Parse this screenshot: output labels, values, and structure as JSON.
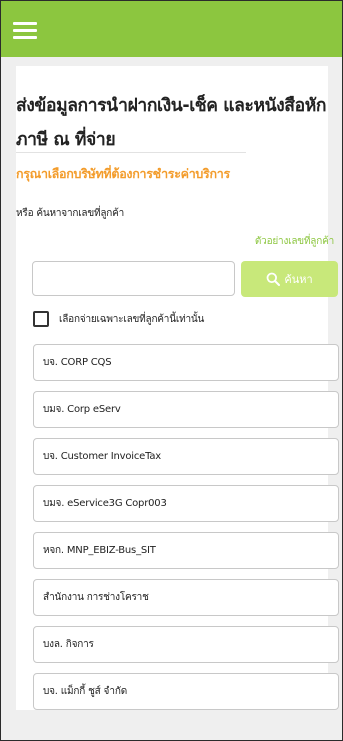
{
  "header": {
    "menu_icon": "hamburger-menu-icon",
    "color": "#8cc63f"
  },
  "page": {
    "title": "ส่งข้อมูลการนำฝากเงิน-เช็ค และหนังสือหักภาษี ณ ที่จ่าย",
    "subtitle": "กรุณาเลือกบริษัทที่ต้องการชำระค่าบริการ",
    "search_hint": "หรือ ค้นหาจากเลขที่ลูกค้า",
    "example_link": "ตัวอย่างเลขที่ลูกค้า"
  },
  "search": {
    "value": "",
    "placeholder": "",
    "button_label": "ค้นหา",
    "button_icon": "search-icon"
  },
  "filter": {
    "checkbox_label": "เลือกจ่ายเฉพาะเลขที่ลูกค้านี้เท่านั้น",
    "checked": false
  },
  "companies": [
    "บจ. CORP CQS",
    "บมจ. Corp eServ",
    "บจ. Customer InvoiceTax",
    "บมจ. eService3G Copr003",
    "หจก. MNP_EBIZ-Bus_SIT",
    "สำนักงาน การช่างโคราช",
    "บงล. กิจการ",
    "บจ. แม็กกี้ ชูส์  จำกัด"
  ],
  "colors": {
    "accent": "#8cc63f",
    "subtitle": "#f39c2b",
    "search_button": "#c8e87a"
  }
}
